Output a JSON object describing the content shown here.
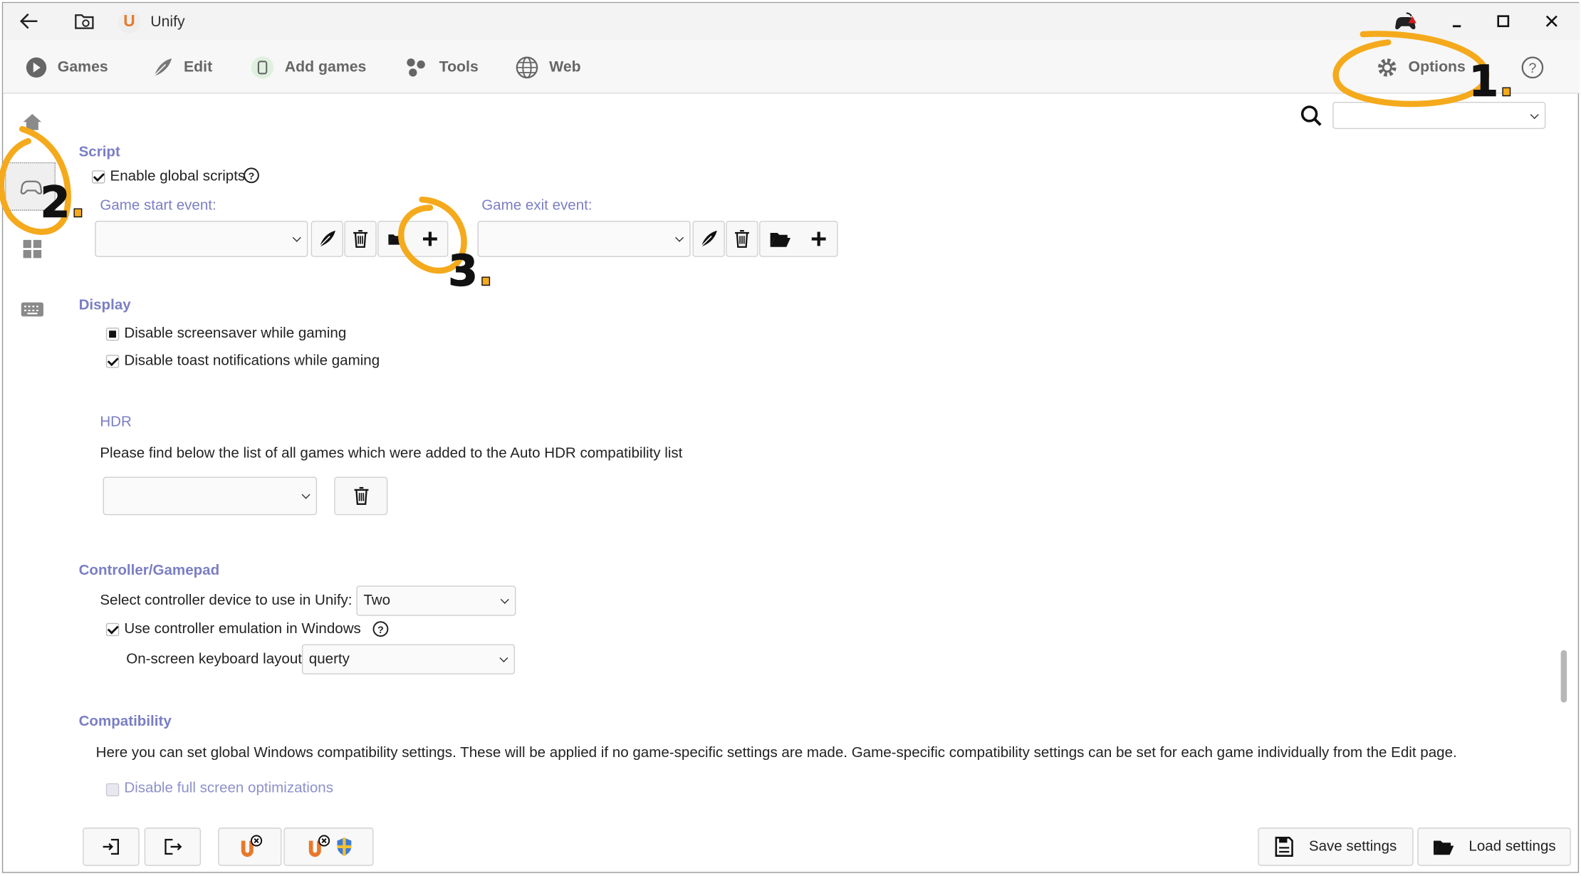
{
  "window": {
    "title": "Unify",
    "app_logo_letter": "U"
  },
  "toolbar": {
    "games": "Games",
    "edit": "Edit",
    "add_games": "Add games",
    "tools": "Tools",
    "web": "Web",
    "options": "Options"
  },
  "search": {
    "value": ""
  },
  "script": {
    "title": "Script",
    "enable_global_scripts": "Enable global scripts",
    "enable_global_scripts_checked": true,
    "game_start_event": "Game start event:",
    "game_start_value": "",
    "game_exit_event": "Game exit event:",
    "game_exit_value": ""
  },
  "display": {
    "title": "Display",
    "disable_screensaver": "Disable screensaver while gaming",
    "disable_toast": "Disable toast notifications while gaming"
  },
  "hdr": {
    "title": "HDR",
    "description": "Please find below the list of all games which were added to the Auto HDR compatibility list",
    "value": ""
  },
  "controller": {
    "title": "Controller/Gamepad",
    "select_device_label": "Select controller device to use in Unify:",
    "select_device_value": "Two",
    "use_emulation": "Use controller emulation in Windows",
    "keyboard_layout_label": "On-screen keyboard layout",
    "keyboard_layout_value": "querty"
  },
  "compatibility": {
    "title": "Compatibility",
    "description": "Here you can set global Windows compatibility settings. These will be applied if no game-specific settings are made. Game-specific compatibility settings can be set for each game individually from the Edit page.",
    "disable_fullscreen_opt": "Disable full screen optimizations"
  },
  "footer": {
    "save_settings": "Save settings",
    "load_settings": "Load settings"
  },
  "annotations": {
    "one": "1",
    "two": "2",
    "three": "3"
  },
  "colors": {
    "accent": "#7b7ec4",
    "highlight": "#f4aa1c",
    "logo": "#e8782a"
  }
}
